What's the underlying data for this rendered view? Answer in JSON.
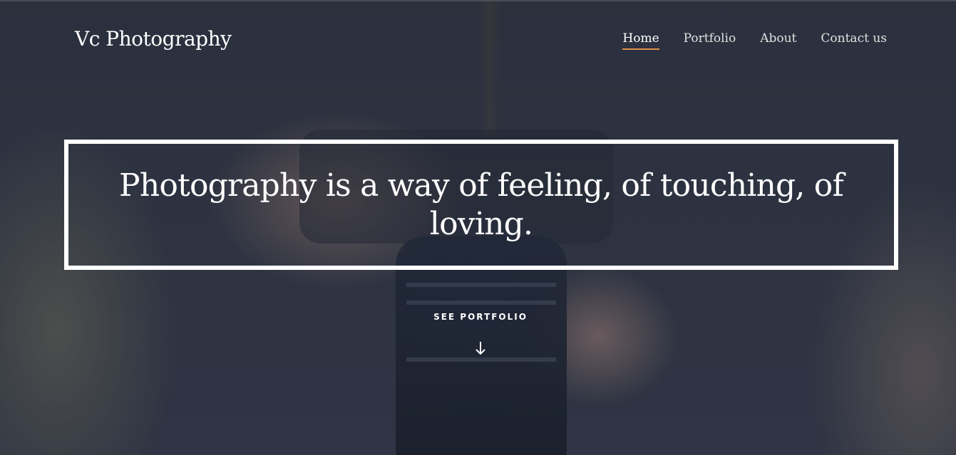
{
  "header": {
    "brand": "Vc Photography",
    "nav": [
      {
        "label": "Home",
        "active": true
      },
      {
        "label": "Portfolio",
        "active": false
      },
      {
        "label": "About",
        "active": false
      },
      {
        "label": "Contact us",
        "active": false
      }
    ]
  },
  "hero": {
    "quote": "Photography is a way of feeling, of touching, of loving.",
    "cta_label": "SEE PORTFOLIO",
    "cta_icon": "arrow-down-icon"
  },
  "colors": {
    "nav_active_underline": "#e0904c",
    "text": "#ffffff",
    "background": "#2f3544"
  }
}
